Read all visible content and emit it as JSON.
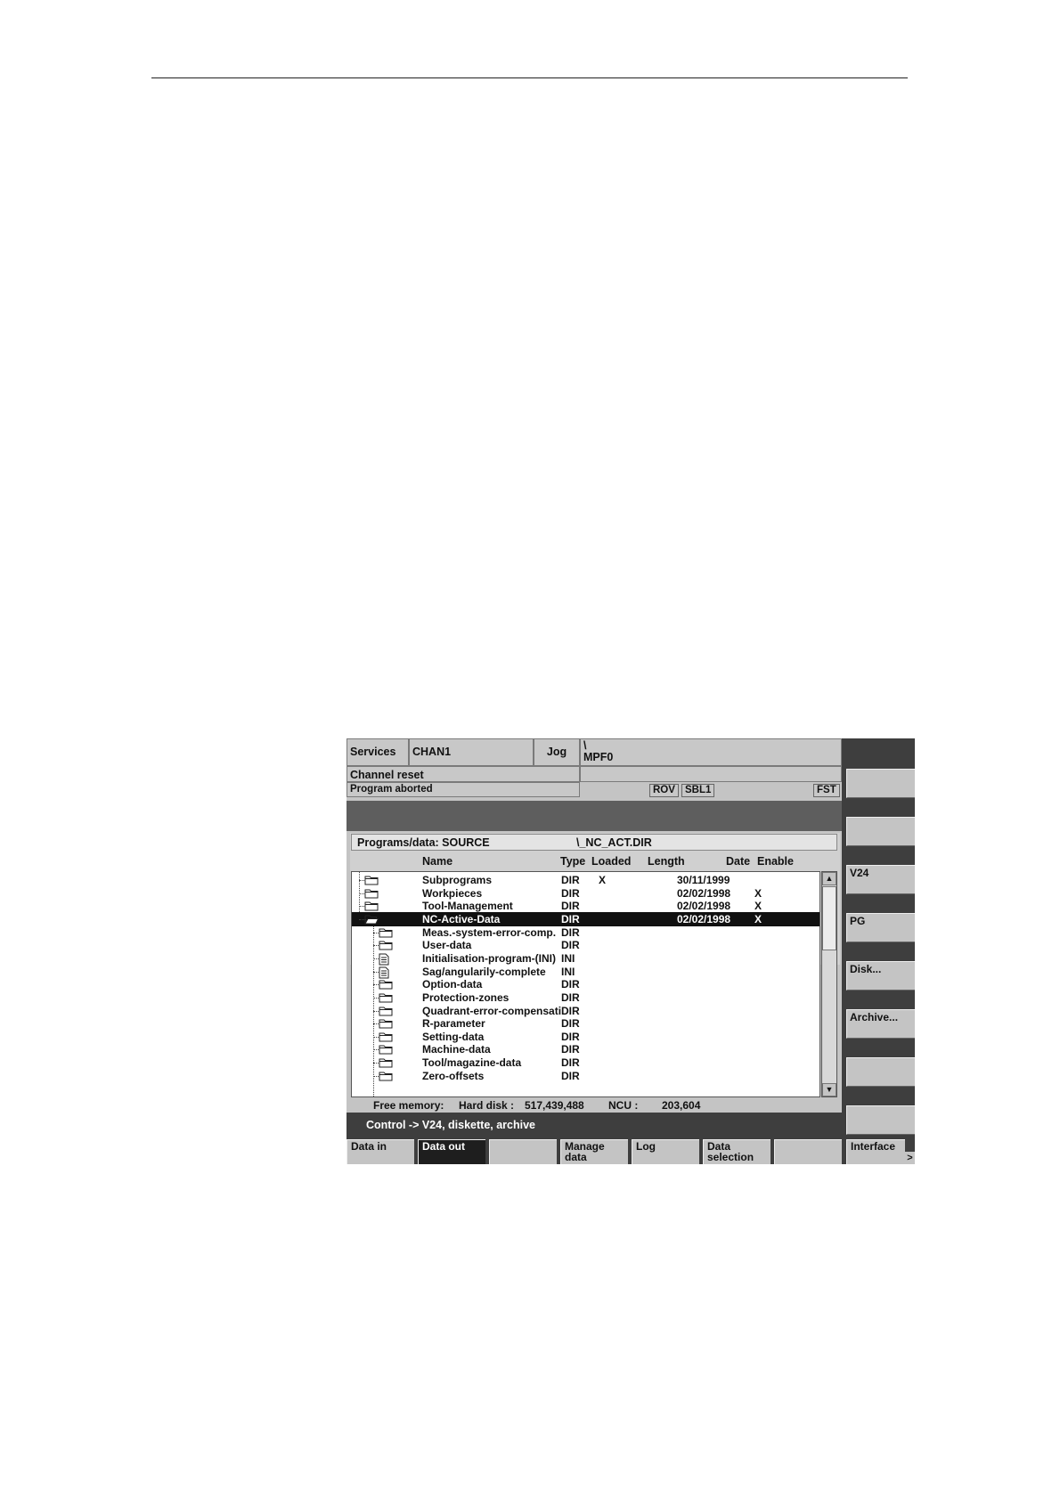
{
  "header": {
    "area": "Services",
    "channel": "CHAN1",
    "mode": "Jog",
    "path_line1": "\\",
    "path_line2": "MPF0",
    "channel_status": "Channel reset",
    "program_status": "Program aborted",
    "flags": [
      "ROV",
      "SBL1",
      "FST"
    ]
  },
  "browser": {
    "location_label": "Programs/data: SOURCE",
    "location_path": "\\_NC_ACT.DIR",
    "columns": {
      "name": "Name",
      "type": "Type",
      "loaded": "Loaded",
      "length": "Length",
      "date": "Date",
      "enable": "Enable"
    },
    "rows": [
      {
        "name": "Subprograms",
        "type": "DIR",
        "loaded": "X",
        "date": "30/11/1999",
        "enable": "",
        "icon": "folder-icon",
        "level": 0
      },
      {
        "name": "Workpieces",
        "type": "DIR",
        "loaded": "",
        "date": "02/02/1998",
        "enable": "X",
        "icon": "folder-icon",
        "level": 0
      },
      {
        "name": "Tool-Management",
        "type": "DIR",
        "loaded": "",
        "date": "02/02/1998",
        "enable": "X",
        "icon": "folder-icon",
        "level": 0
      },
      {
        "name": "NC-Active-Data",
        "type": "DIR",
        "loaded": "",
        "date": "02/02/1998",
        "enable": "X",
        "icon": "open-folder-icon",
        "level": 0,
        "selected": true
      },
      {
        "name": "Meas.-system-error-comp.",
        "type": "DIR",
        "loaded": "",
        "date": "",
        "enable": "",
        "icon": "folder-icon",
        "level": 1
      },
      {
        "name": "User-data",
        "type": "DIR",
        "loaded": "",
        "date": "",
        "enable": "",
        "icon": "folder-icon",
        "level": 1
      },
      {
        "name": "Initialisation-program-(INI)",
        "type": "INI",
        "loaded": "",
        "date": "",
        "enable": "",
        "icon": "document-icon",
        "level": 1
      },
      {
        "name": "Sag/angularily-complete",
        "type": "INI",
        "loaded": "",
        "date": "",
        "enable": "",
        "icon": "document-icon",
        "level": 1
      },
      {
        "name": "Option-data",
        "type": "DIR",
        "loaded": "",
        "date": "",
        "enable": "",
        "icon": "folder-icon",
        "level": 1
      },
      {
        "name": "Protection-zones",
        "type": "DIR",
        "loaded": "",
        "date": "",
        "enable": "",
        "icon": "folder-icon",
        "level": 1
      },
      {
        "name": "Quadrant-error-compensati",
        "type": "DIR",
        "loaded": "",
        "date": "",
        "enable": "",
        "icon": "folder-icon",
        "level": 1
      },
      {
        "name": "R-parameter",
        "type": "DIR",
        "loaded": "",
        "date": "",
        "enable": "",
        "icon": "folder-icon",
        "level": 1
      },
      {
        "name": "Setting-data",
        "type": "DIR",
        "loaded": "",
        "date": "",
        "enable": "",
        "icon": "folder-icon",
        "level": 1
      },
      {
        "name": "Machine-data",
        "type": "DIR",
        "loaded": "",
        "date": "",
        "enable": "",
        "icon": "folder-icon",
        "level": 1
      },
      {
        "name": "Tool/magazine-data",
        "type": "DIR",
        "loaded": "",
        "date": "",
        "enable": "",
        "icon": "folder-icon",
        "level": 1
      },
      {
        "name": "Zero-offsets",
        "type": "DIR",
        "loaded": "",
        "date": "",
        "enable": "",
        "icon": "folder-icon",
        "level": 1
      }
    ]
  },
  "memory": {
    "label": "Free memory:",
    "hard_disk_label": "Hard disk :",
    "hard_disk_value": "517,439,488",
    "ncu_label": "NCU :",
    "ncu_value": "203,604"
  },
  "info_line": "Control -> V24, diskette, archive",
  "vertical_softkeys": [
    "",
    "",
    "V24",
    "PG",
    "Disk...",
    "Archive...",
    "",
    ""
  ],
  "horizontal_softkeys": [
    {
      "label": "Data in",
      "active": false
    },
    {
      "label": "Data out",
      "active": true
    },
    {
      "label": "",
      "active": false
    },
    {
      "label": "Manage\ndata",
      "active": false
    },
    {
      "label": "Log",
      "active": false
    },
    {
      "label": "Data\nselection",
      "active": false
    },
    {
      "label": "",
      "active": false
    },
    {
      "label": "Interface",
      "active": false
    }
  ],
  "more_indicator": ">"
}
